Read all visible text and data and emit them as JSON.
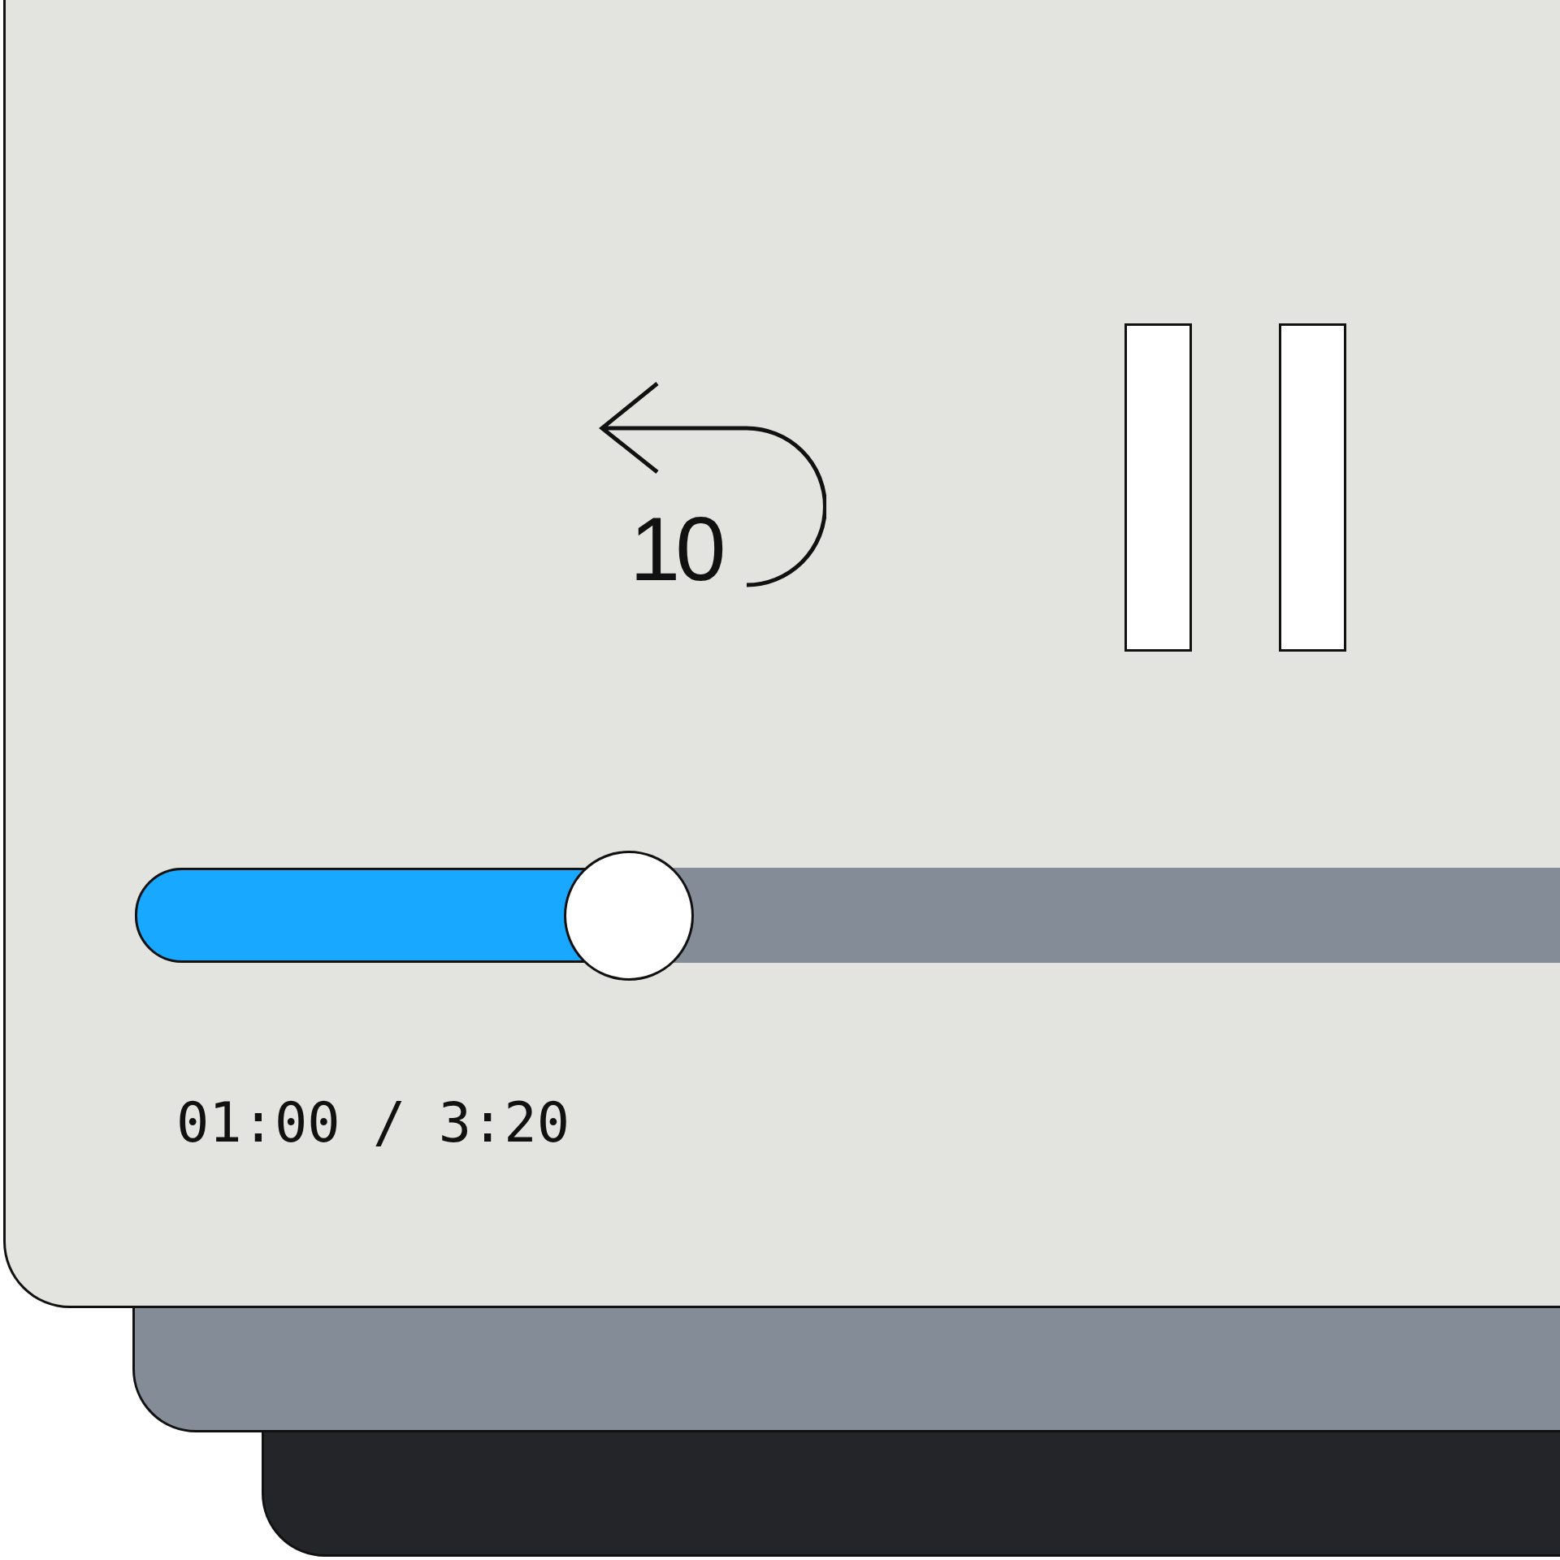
{
  "player": {
    "rewind_button": {
      "label": "10"
    },
    "playing": true,
    "progress": {
      "level": 0.3
    },
    "time": "01:00 / 3:20"
  }
}
